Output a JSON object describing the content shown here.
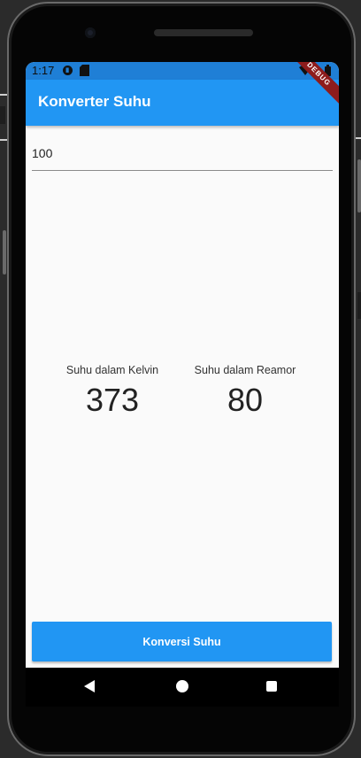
{
  "status_bar": {
    "time": "1:17",
    "icons": [
      "data-saver-icon",
      "sd-card-icon",
      "wifi-icon",
      "battery-icon"
    ]
  },
  "app_bar": {
    "title": "Konverter Suhu",
    "debug_banner": "DEBUG"
  },
  "input": {
    "value": "100"
  },
  "results": {
    "kelvin_label": "Suhu dalam Kelvin",
    "kelvin_value": "373",
    "reamor_label": "Suhu dalam Reamor",
    "reamor_value": "80"
  },
  "convert_button": {
    "label": "Konversi Suhu"
  },
  "nav_bar": {
    "icons": [
      "back-icon",
      "home-icon",
      "recent-apps-icon"
    ]
  },
  "colors": {
    "primary": "#2196f3",
    "status_bar": "#1f7fd6",
    "background": "#fafafa"
  }
}
